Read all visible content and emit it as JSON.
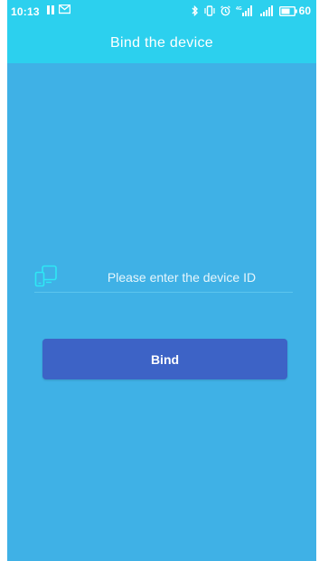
{
  "status_bar": {
    "time": "10:13",
    "battery_level": "60",
    "left_icons": [
      "pause-icon",
      "message-icon"
    ],
    "right_icons": [
      "bluetooth-icon",
      "vibrate-icon",
      "alarm-icon",
      "signal-icon",
      "signal-icon",
      "battery-icon"
    ]
  },
  "header": {
    "title": "Bind the device"
  },
  "form": {
    "device_id_placeholder": "Please enter the device ID",
    "device_id_value": "",
    "bind_label": "Bind"
  },
  "colors": {
    "background": "#3fb1e6",
    "header": "#2cd0ee",
    "button": "#3d63c6",
    "icon_accent": "#2ee8f5"
  }
}
